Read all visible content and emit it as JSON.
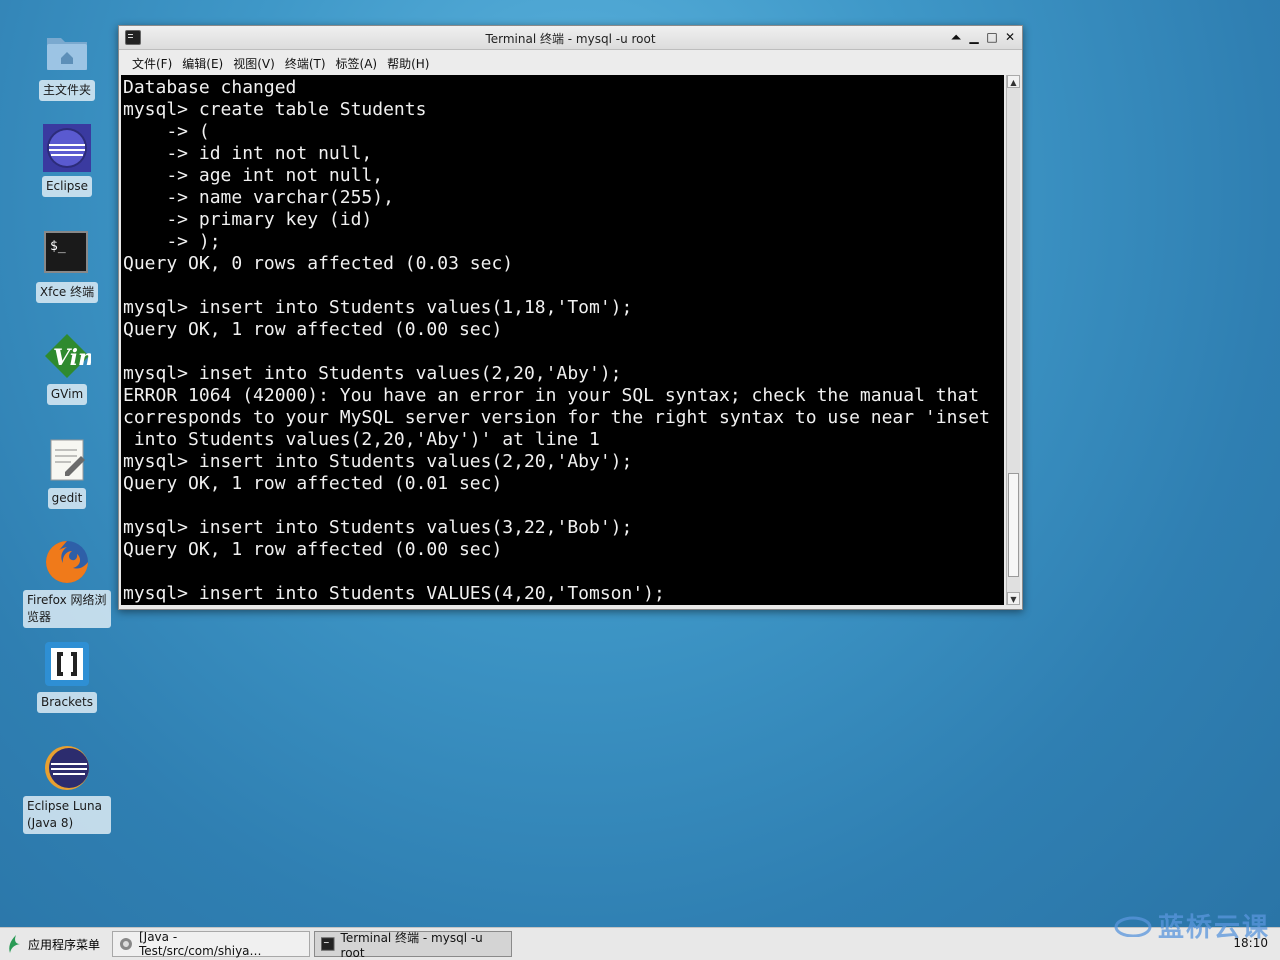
{
  "desktop": {
    "icons": [
      {
        "label": "主文件夹",
        "icon": "home-folder-icon"
      },
      {
        "label": "Eclipse",
        "icon": "eclipse-icon"
      },
      {
        "label": "Xfce 终端",
        "icon": "terminal-icon"
      },
      {
        "label": "GVim",
        "icon": "gvim-icon"
      },
      {
        "label": "gedit",
        "icon": "gedit-icon"
      },
      {
        "label": "Firefox 网络浏览器",
        "icon": "firefox-icon"
      },
      {
        "label": "Brackets",
        "icon": "brackets-icon"
      },
      {
        "label": "Eclipse Luna (Java 8)",
        "icon": "eclipse-luna-icon"
      }
    ]
  },
  "window": {
    "title": "Terminal 终端 - mysql -u root",
    "menu": [
      "文件(F)",
      "编辑(E)",
      "视图(V)",
      "终端(T)",
      "标签(A)",
      "帮助(H)"
    ],
    "terminal_lines": [
      "Database changed",
      "mysql> create table Students",
      "    -> (",
      "    -> id int not null,",
      "    -> age int not null,",
      "    -> name varchar(255),",
      "    -> primary key (id)",
      "    -> );",
      "Query OK, 0 rows affected (0.03 sec)",
      "",
      "mysql> insert into Students values(1,18,'Tom');",
      "Query OK, 1 row affected (0.00 sec)",
      "",
      "mysql> inset into Students values(2,20,'Aby');",
      "ERROR 1064 (42000): You have an error in your SQL syntax; check the manual that",
      "corresponds to your MySQL server version for the right syntax to use near 'inset",
      " into Students values(2,20,'Aby')' at line 1",
      "mysql> insert into Students values(2,20,'Aby');",
      "Query OK, 1 row affected (0.01 sec)",
      "",
      "mysql> insert into Students values(3,22,'Bob');",
      "Query OK, 1 row affected (0.00 sec)",
      "",
      "mysql> insert into Students VALUES(4,20,'Tomson');"
    ]
  },
  "taskbar": {
    "start_label": "应用程序菜单",
    "tasks": [
      {
        "label": "[Java - Test/src/com/shiya…",
        "active": false
      },
      {
        "label": "Terminal 终端 - mysql -u root",
        "active": true
      }
    ],
    "clock": "18:10",
    "watermark": "蓝桥云课"
  }
}
